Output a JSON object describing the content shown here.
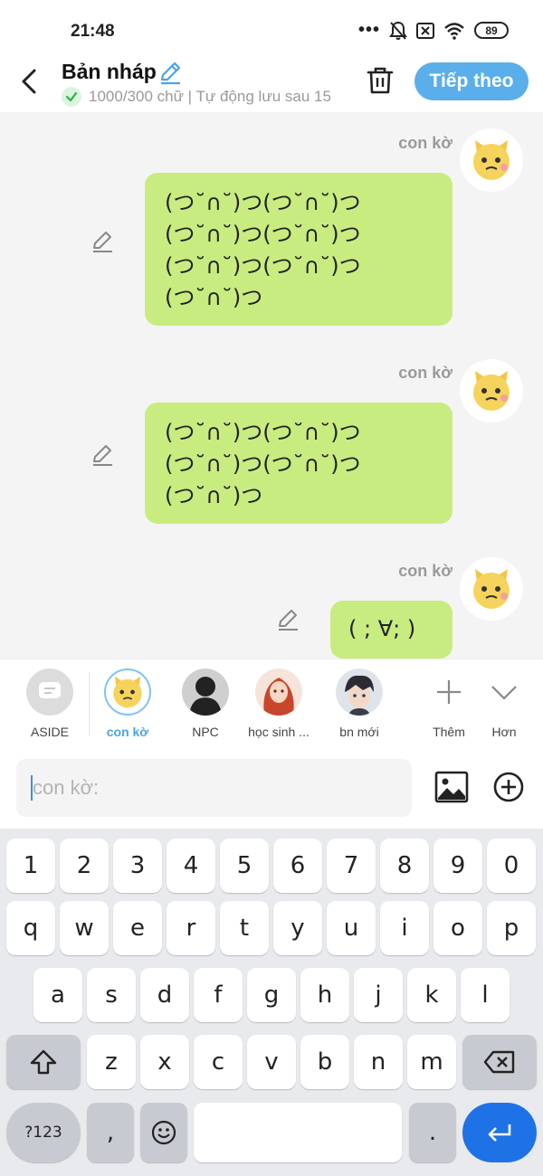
{
  "status_bar": {
    "time": "21:48",
    "battery": "89"
  },
  "header": {
    "title": "Bản nháp",
    "subtitle": "1000/300 chữ | Tự động lưu sau 15",
    "next_label": "Tiếp theo"
  },
  "chat": {
    "messages": [
      {
        "sender": "con kờ",
        "text": "(つ˘∩˘)つ(つ˘∩˘)つ\n(つ˘∩˘)つ(つ˘∩˘)つ\n(つ˘∩˘)つ(つ˘∩˘)つ\n(つ˘∩˘)つ"
      },
      {
        "sender": "con kờ",
        "text": "(つ˘∩˘)つ(つ˘∩˘)つ\n(つ˘∩˘)つ(つ˘∩˘)つ\n(つ˘∩˘)つ"
      },
      {
        "sender": "con kờ",
        "text": "( ; ∀; )"
      }
    ]
  },
  "characters": [
    {
      "label": "ASIDE"
    },
    {
      "label": "con kờ"
    },
    {
      "label": "NPC"
    },
    {
      "label": "học sinh ..."
    },
    {
      "label": "bn mới"
    },
    {
      "label": "Thêm"
    },
    {
      "label": "Hơn"
    }
  ],
  "input": {
    "placeholder": "con kờ:"
  },
  "keyboard": {
    "row_numbers": [
      "1",
      "2",
      "3",
      "4",
      "5",
      "6",
      "7",
      "8",
      "9",
      "0"
    ],
    "row_1": [
      "q",
      "w",
      "e",
      "r",
      "t",
      "y",
      "u",
      "i",
      "o",
      "p"
    ],
    "row_2": [
      "a",
      "s",
      "d",
      "f",
      "g",
      "h",
      "j",
      "k",
      "l"
    ],
    "row_3": [
      "z",
      "x",
      "c",
      "v",
      "b",
      "n",
      "m"
    ],
    "symbols_label": "?123",
    "comma": ",",
    "period": "."
  },
  "colors": {
    "accent": "#5aaeea",
    "bubble": "#c9ec80",
    "enter": "#1f72e6",
    "active_label": "#4aa3e8"
  },
  "icons": [
    "back-icon",
    "pencil-icon",
    "check-icon",
    "trash-icon",
    "image-icon",
    "plus-circle-icon",
    "backspace-icon",
    "shift-icon",
    "emoji-icon",
    "enter-icon"
  ]
}
